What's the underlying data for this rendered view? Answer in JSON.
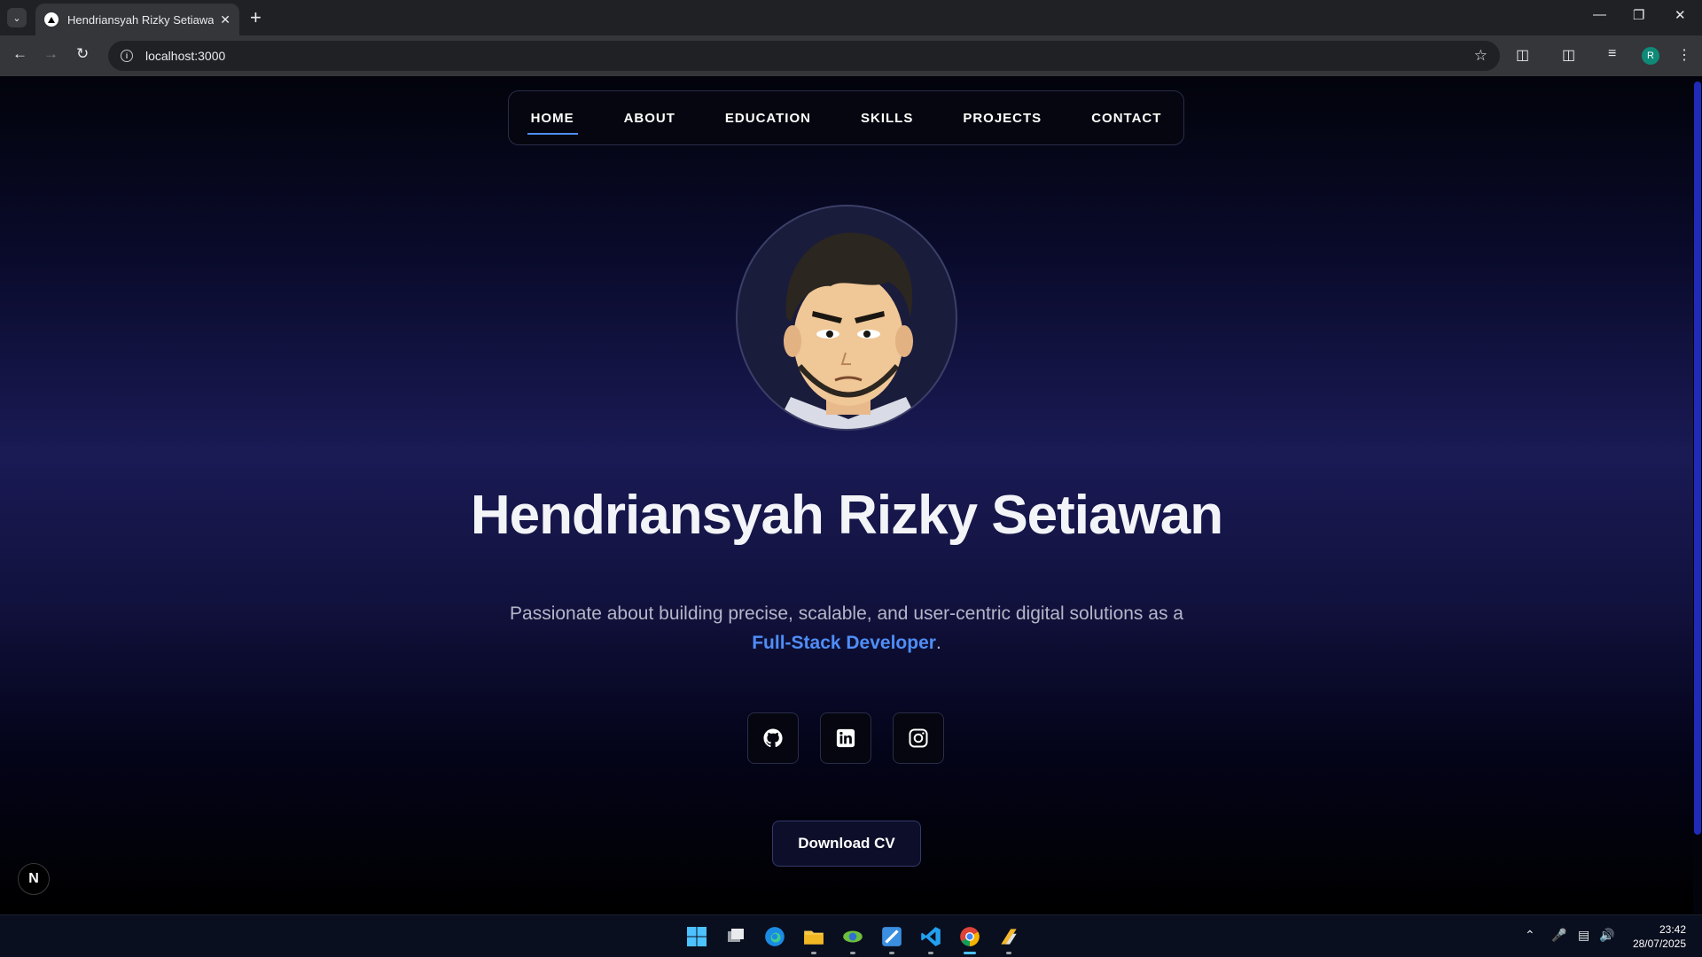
{
  "browser": {
    "tab_title": "Hendriansyah Rizky Setiawan -",
    "url": "localhost:3000",
    "profile_initial": "R"
  },
  "navbar": {
    "links": [
      "HOME",
      "ABOUT",
      "EDUCATION",
      "SKILLS",
      "PROJECTS",
      "CONTACT"
    ],
    "active": "HOME"
  },
  "hero": {
    "name": "Hendriansyah Rizky Setiawan",
    "description_before": "Passionate about building precise, scalable, and user-centric digital solutions as a ",
    "description_highlight": "Full-Stack Developer",
    "description_after": ".",
    "socials": [
      "github-icon",
      "linkedin-icon",
      "instagram-icon"
    ],
    "cv_button": "Download CV"
  },
  "dev_badge": "N",
  "taskbar": {
    "time": "23:42",
    "date": "28/07/2025",
    "apps": [
      "windows-start-icon",
      "task-view-icon",
      "edge-icon",
      "file-explorer-icon",
      "app-icon",
      "app-icon",
      "vscode-icon",
      "chrome-icon",
      "app-icon"
    ]
  },
  "colors": {
    "accent": "#4f8ef7",
    "background_mid": "#1a1a55"
  }
}
